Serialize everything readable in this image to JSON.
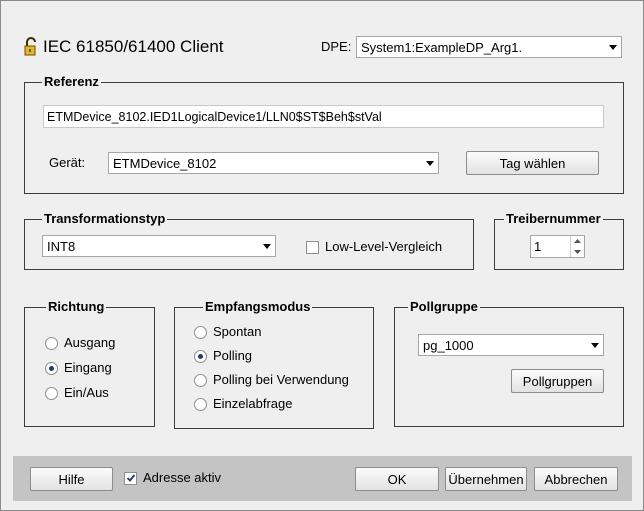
{
  "header": {
    "title": "IEC 61850/61400 Client",
    "dpe_label": "DPE:",
    "dpe_value": "System1:ExampleDP_Arg1."
  },
  "referenz": {
    "legend": "Referenz",
    "reference_value": "ETMDevice_8102.IED1LogicalDevice1/LLN0$ST$Beh$stVal",
    "geraet_label": "Gerät:",
    "geraet_value": "ETMDevice_8102",
    "tag_button": "Tag wählen"
  },
  "transformation": {
    "legend": "Transformationstyp",
    "value": "INT8",
    "low_level_label": "Low-Level-Vergleich",
    "low_level_checked": false
  },
  "treiber": {
    "legend": "Treibernummer",
    "value": "1"
  },
  "richtung": {
    "legend": "Richtung",
    "options": [
      {
        "label": "Ausgang",
        "selected": false
      },
      {
        "label": "Eingang",
        "selected": true
      },
      {
        "label": "Ein/Aus",
        "selected": false
      }
    ]
  },
  "empfang": {
    "legend": "Empfangsmodus",
    "options": [
      {
        "label": "Spontan",
        "selected": false
      },
      {
        "label": "Polling",
        "selected": true
      },
      {
        "label": "Polling bei Verwendung",
        "selected": false
      },
      {
        "label": "Einzelabfrage",
        "selected": false
      }
    ]
  },
  "pollgruppe": {
    "legend": "Pollgruppe",
    "value": "pg_1000",
    "button": "Pollgruppen"
  },
  "footer": {
    "hilfe": "Hilfe",
    "adresse_label": "Adresse aktiv",
    "adresse_checked": true,
    "ok": "OK",
    "uebernehmen": "Übernehmen",
    "abbrechen": "Abbrechen"
  },
  "icons": {
    "lock": "lock-icon",
    "dropdown": "chevron-down-icon",
    "spin_up": "spin-up-icon",
    "spin_down": "spin-down-icon",
    "check": "check-icon"
  }
}
